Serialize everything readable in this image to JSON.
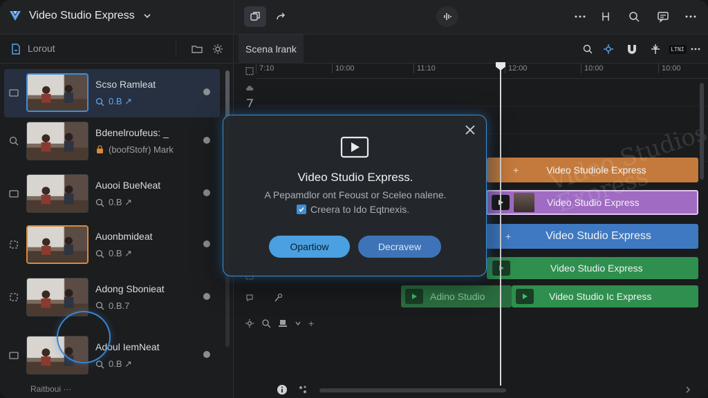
{
  "app": {
    "title": "Video Studio Express"
  },
  "left_panel": {
    "header_label": "Lorout",
    "clips": [
      {
        "name": "Scso Ramleat",
        "meta": "0.B ↗",
        "meta_icon": "search-icon",
        "selected": true,
        "border": "blue"
      },
      {
        "name": "Bdenelroufeus:  _",
        "meta": "(boofStofr) Mark",
        "meta_icon": "lock-icon",
        "selected": false,
        "border": "none"
      },
      {
        "name": "Auooi BueNeat",
        "meta": "0.B ↗",
        "meta_icon": "search-icon",
        "selected": false,
        "border": "none"
      },
      {
        "name": "Auonbmideat",
        "meta": "0.B ↗",
        "meta_icon": "search-icon",
        "selected": false,
        "border": "orange"
      },
      {
        "name": "Adong Sbonieat",
        "meta": "0.B.7",
        "meta_icon": "search-icon",
        "selected": false,
        "border": "none"
      },
      {
        "name": "Adoul IemNeat",
        "meta": "0.B ↗",
        "meta_icon": "search-icon",
        "selected": false,
        "border": "none"
      }
    ],
    "footer": "Raitboui ···"
  },
  "timeline": {
    "tab_label": "Scena lrank",
    "toolbar_box": "LTNI",
    "ruler_ticks": [
      "7:10",
      "10:00",
      "11:10",
      "12:00",
      "10:00",
      "10:00"
    ],
    "track_clips": [
      {
        "label": "Video Studiole Express",
        "color": "orange"
      },
      {
        "label": "Video Studio Express",
        "color": "purple"
      },
      {
        "label": "Video Studio Express",
        "color": "blue"
      },
      {
        "label": "Video Studio Express",
        "color": "green"
      },
      {
        "label": "Video Studio Ic Express",
        "color": "green"
      },
      {
        "label": "Adino Studio",
        "color": "green-faded"
      }
    ],
    "watermark": "Video Studios\nExpress"
  },
  "dialog": {
    "title": "Video Studio Express.",
    "subtitle": "A Pepamdlor ont Feoust or Sceleo nalene.",
    "checkbox_label": "Creera to Ido Eqtnexis.",
    "checkbox_checked": true,
    "primary_button": "Opartiow",
    "secondary_button": "Decravew"
  },
  "colors": {
    "accent": "#3d8fd6",
    "orange_clip": "#c47a3c",
    "purple_clip": "#a06bc2",
    "blue_clip": "#3f79c2",
    "green_clip": "#2f8f4e"
  }
}
